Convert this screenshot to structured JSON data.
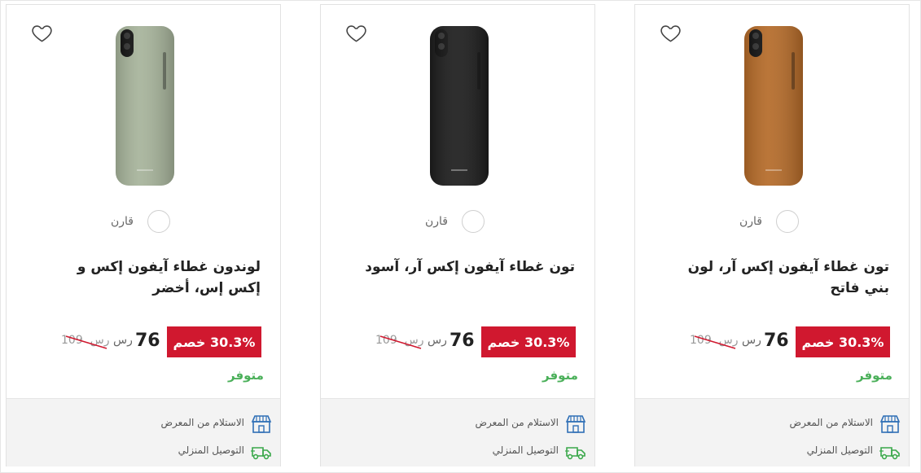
{
  "products": [
    {
      "title": "تون غطاء آيفون إكس آر، لون بني فاتح",
      "compare_label": "قارن",
      "discount": "30.3% خصم",
      "price": "76",
      "currency": "رس",
      "old_price": "109",
      "old_currency": "رس",
      "availability": "متوفر",
      "pickup_label": "الاستلام من المعرض",
      "delivery_label": "التوصيل المنزلي",
      "color": "#b46a28"
    },
    {
      "title": "تون غطاء آيفون إكس آر، آسود",
      "compare_label": "قارن",
      "discount": "30.3% خصم",
      "price": "76",
      "currency": "رس",
      "old_price": "109",
      "old_currency": "رس",
      "availability": "متوفر",
      "pickup_label": "الاستلام من المعرض",
      "delivery_label": "التوصيل المنزلي",
      "color": "#1c1c1c"
    },
    {
      "title": "لوندون غطاء آيفون إكس و إكس إس، أخضر",
      "compare_label": "قارن",
      "discount": "30.3% خصم",
      "price": "76",
      "currency": "رس",
      "old_price": "109",
      "old_currency": "رس",
      "availability": "متوفر",
      "pickup_label": "الاستلام من المعرض",
      "delivery_label": "التوصيل المنزلي",
      "color": "#a6b39a"
    }
  ],
  "colors": {
    "discount_bg": "#d0182f",
    "available": "#4bb05a",
    "icon_blue": "#2f6fb6",
    "icon_green": "#3aa84a"
  }
}
